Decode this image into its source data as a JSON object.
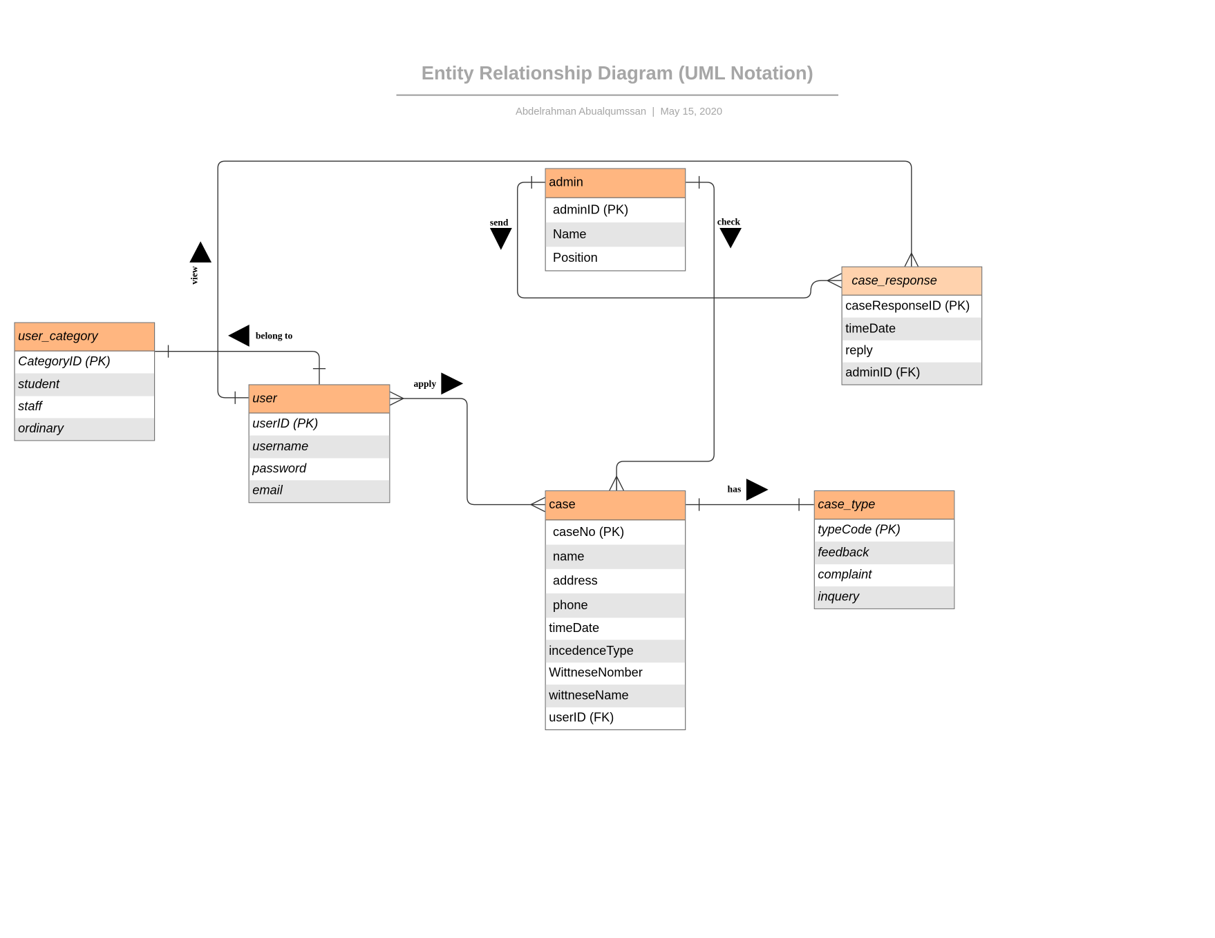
{
  "header": {
    "title": "Entity Relationship Diagram (UML Notation)",
    "author": "Abdelrahman Abualqumssan",
    "separator": "|",
    "date": "May 15, 2020"
  },
  "colors": {
    "entity_header": "#ffb680",
    "entity_header_light": "#ffd2ad",
    "alt_row": "#e5e5e5",
    "title_gray": "#a6a6a6"
  },
  "entities": {
    "admin": {
      "name": "admin",
      "fields": [
        "adminID  (PK)",
        "Name",
        "Position"
      ]
    },
    "case_response": {
      "name": "case_response",
      "fields": [
        "caseResponseID  (PK)",
        "timeDate",
        "reply",
        "adminID (FK)"
      ]
    },
    "user_category": {
      "name": "user_category",
      "fields": [
        "CategoryID (PK)",
        "student",
        "staff",
        "ordinary"
      ]
    },
    "user": {
      "name": "user",
      "fields": [
        "userID (PK)",
        "username",
        "password",
        "email"
      ]
    },
    "case": {
      "name": "case",
      "fields": [
        "caseNo  (PK)",
        "name",
        "address",
        "phone",
        "timeDate",
        "incedenceType",
        "WittneseNomber",
        "wittneseName",
        "userID (FK)"
      ]
    },
    "case_type": {
      "name": "case_type",
      "fields": [
        "typeCode (PK)",
        "feedback",
        "complaint",
        "inquery"
      ]
    }
  },
  "relationships": [
    {
      "label": "send",
      "from": "admin",
      "to": "case_response",
      "direction_icon": "triangle-down"
    },
    {
      "label": "check",
      "from": "admin",
      "to": "case",
      "direction_icon": "triangle-down"
    },
    {
      "label": "view",
      "from": "user",
      "to": "case_response",
      "direction_icon": "triangle-up"
    },
    {
      "label": "belong to",
      "from": "user",
      "to": "user_category",
      "direction_icon": "triangle-left"
    },
    {
      "label": "apply",
      "from": "user",
      "to": "case",
      "direction_icon": "triangle-right"
    },
    {
      "label": "has",
      "from": "case",
      "to": "case_type",
      "direction_icon": "triangle-right"
    }
  ]
}
